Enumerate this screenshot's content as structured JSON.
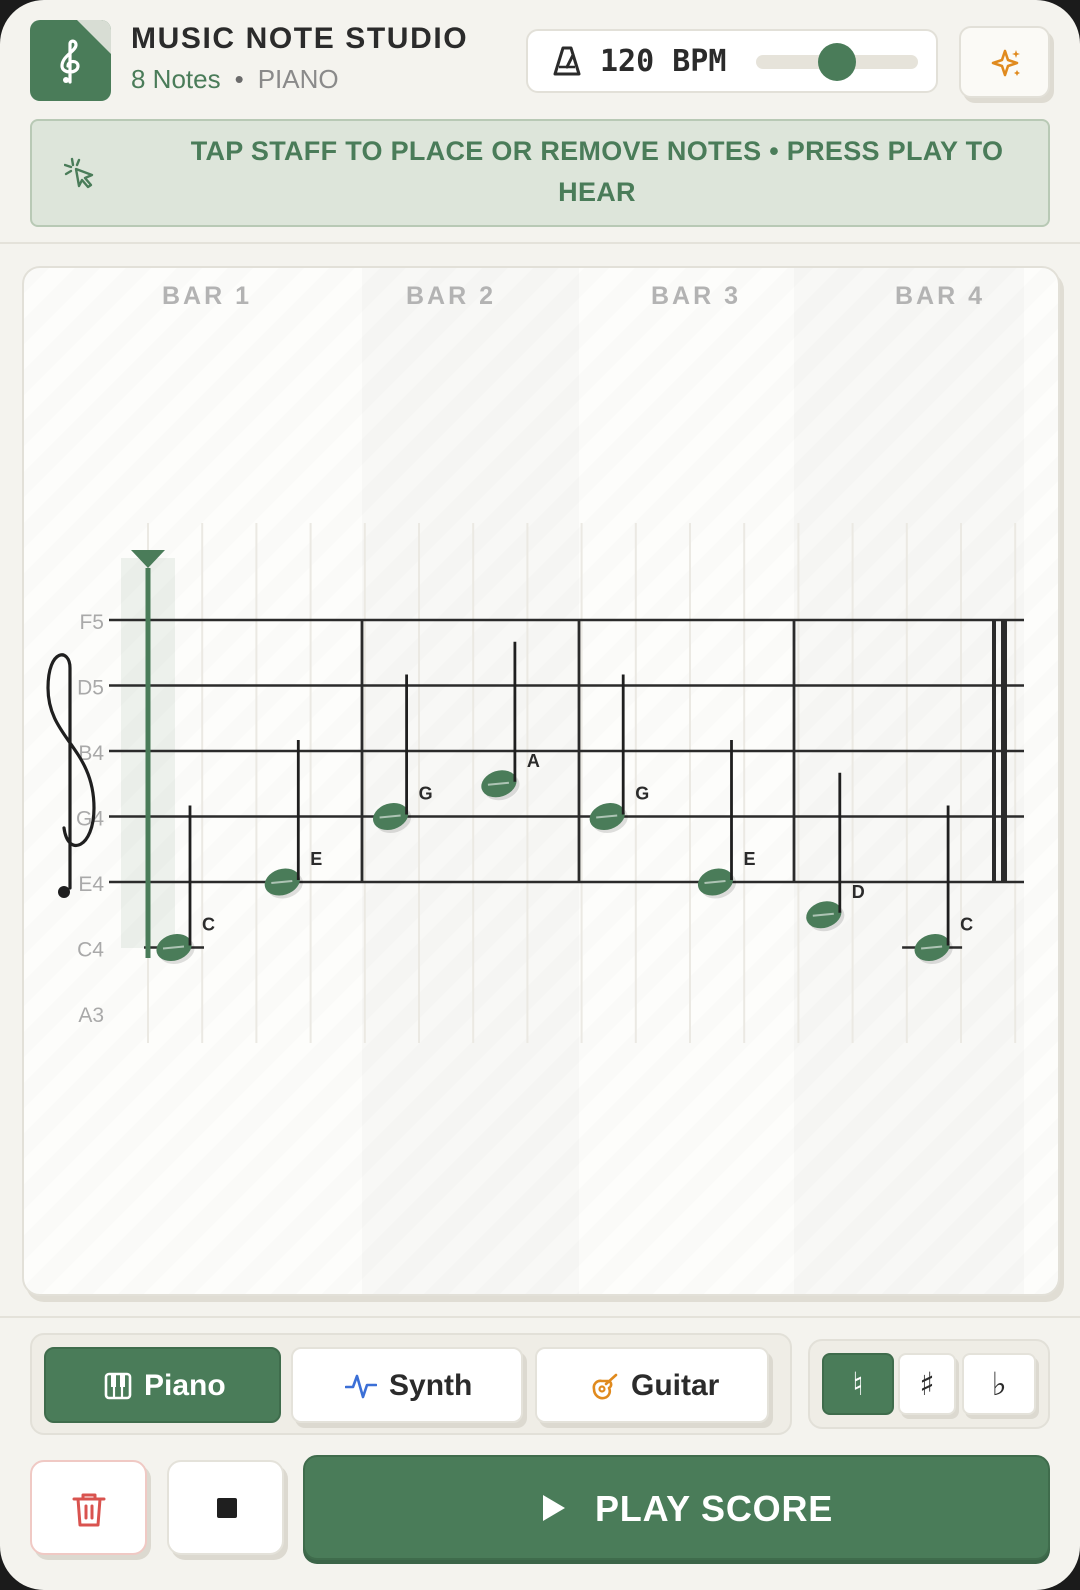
{
  "header": {
    "title": "MUSIC NOTE STUDIO",
    "note_count": "8 Notes",
    "separator": "•",
    "instrument": "PIANO",
    "bpm_label": "120 BPM",
    "bpm_slider_fraction": 0.5
  },
  "hint": {
    "text": "TAP STAFF TO PLACE OR REMOVE NOTES • PRESS PLAY TO HEAR"
  },
  "staff": {
    "bars": [
      "BAR 1",
      "BAR 2",
      "BAR 3",
      "BAR 4"
    ],
    "pitch_labels": [
      "F5",
      "D5",
      "B4",
      "G4",
      "E4",
      "C4",
      "A3"
    ],
    "notes": [
      {
        "name": "C",
        "pitch": "C4"
      },
      {
        "name": "E",
        "pitch": "E4"
      },
      {
        "name": "G",
        "pitch": "G4"
      },
      {
        "name": "A",
        "pitch": "A4"
      },
      {
        "name": "G",
        "pitch": "G4"
      },
      {
        "name": "E",
        "pitch": "E4"
      },
      {
        "name": "D",
        "pitch": "D4"
      },
      {
        "name": "C",
        "pitch": "C4"
      }
    ],
    "playhead_step": 0
  },
  "instruments": {
    "piano": "Piano",
    "synth": "Synth",
    "guitar": "Guitar",
    "selected": "Piano"
  },
  "accidentals": {
    "natural": "♮",
    "sharp": "♯",
    "flat": "♭",
    "selected": "natural"
  },
  "actions": {
    "play_label": "PLAY SCORE"
  },
  "colors": {
    "accent": "#4a7c59",
    "background": "#f4f3ee",
    "hint_bg": "#dde5da",
    "danger": "#d9534f",
    "guitar_icon": "#e08a1e",
    "synth_icon": "#3b6fd6",
    "sparkle_icon": "#e08a1e"
  }
}
